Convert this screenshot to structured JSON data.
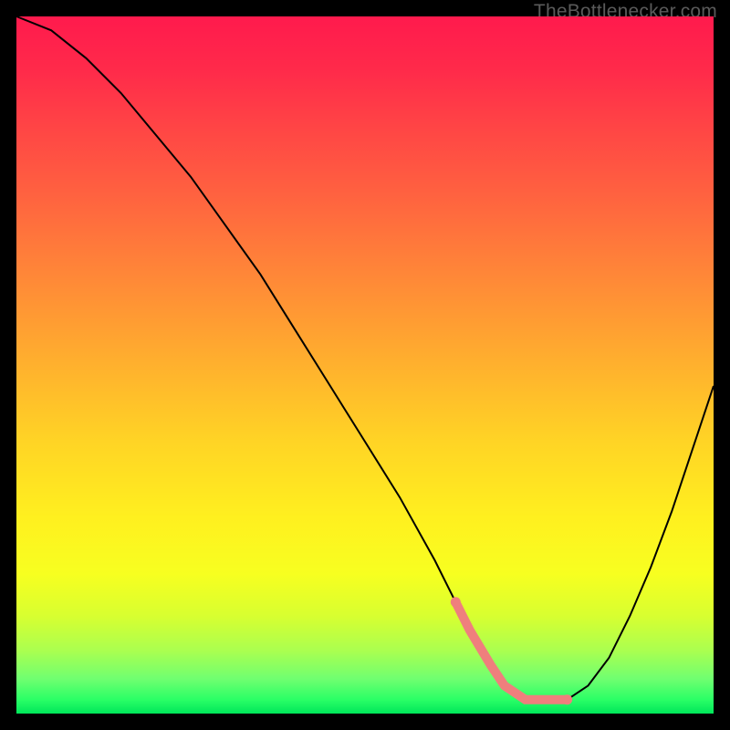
{
  "watermark": "TheBottlenecker.com",
  "colors": {
    "background": "#000000",
    "curve": "#000000",
    "highlight": "#ef7f7d"
  },
  "chart_data": {
    "type": "line",
    "title": "",
    "xlabel": "",
    "ylabel": "",
    "xlim": [
      0,
      100
    ],
    "ylim": [
      0,
      100
    ],
    "series": [
      {
        "name": "bottleneck-curve",
        "x": [
          0,
          5,
          10,
          15,
          20,
          25,
          30,
          35,
          40,
          45,
          50,
          55,
          60,
          63,
          65,
          68,
          70,
          73,
          76,
          79,
          82,
          85,
          88,
          91,
          94,
          97,
          100
        ],
        "values": [
          100,
          98,
          94,
          89,
          83,
          77,
          70,
          63,
          55,
          47,
          39,
          31,
          22,
          16,
          12,
          7,
          4,
          2,
          2,
          2,
          4,
          8,
          14,
          21,
          29,
          38,
          47
        ]
      }
    ],
    "optimal_range": {
      "x_start": 63,
      "x_end": 79,
      "y": 2
    },
    "optimal_range_markers": [
      {
        "x": 63,
        "y": 16
      },
      {
        "x": 79,
        "y": 2
      }
    ]
  }
}
